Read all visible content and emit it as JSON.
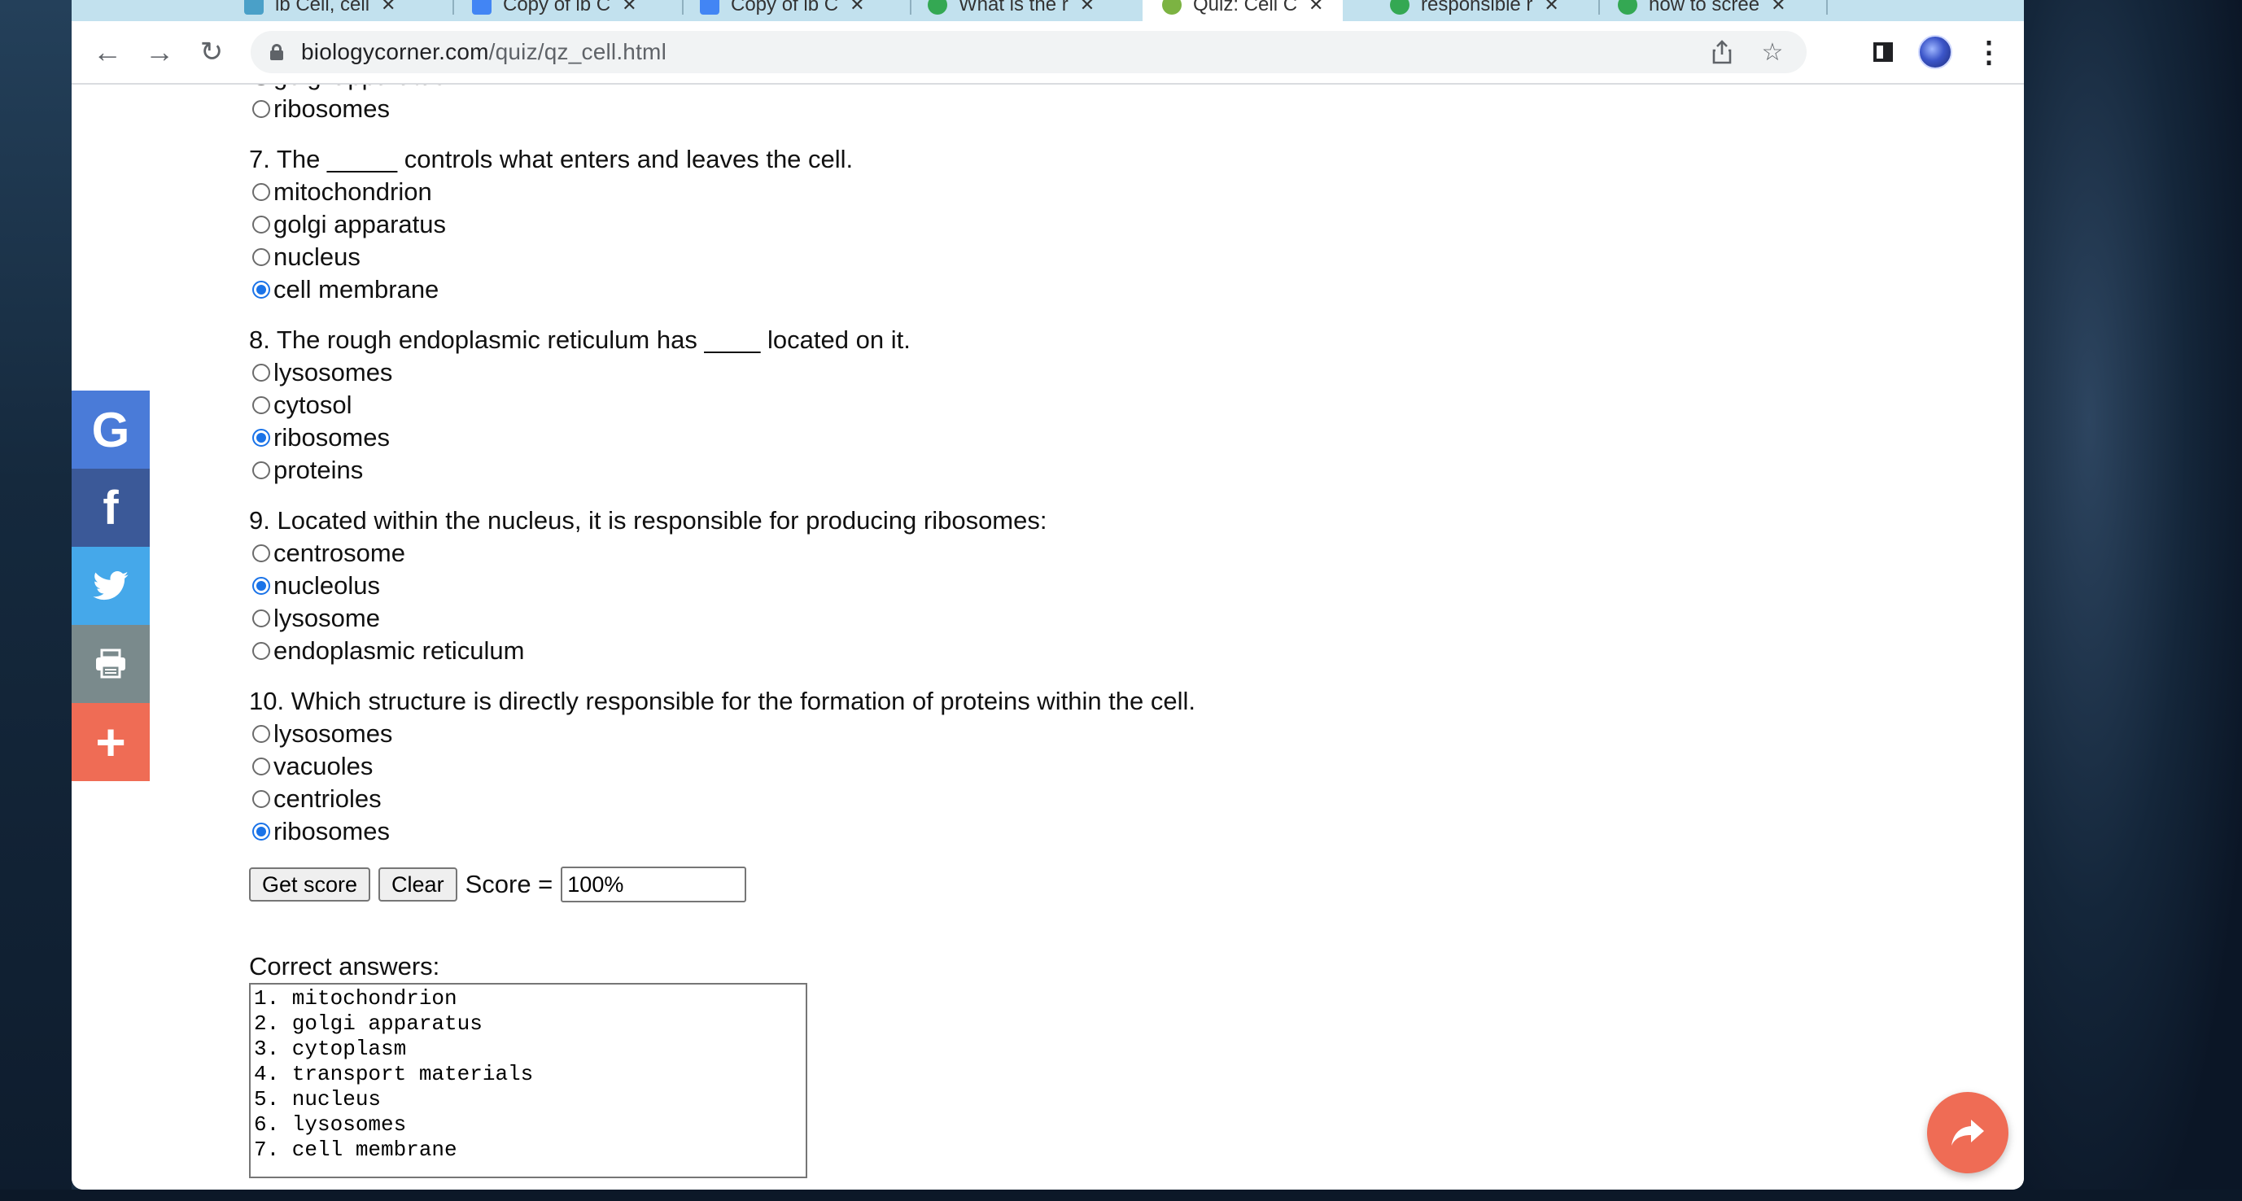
{
  "browser": {
    "tabs": [
      {
        "label": "ib Cell, cell"
      },
      {
        "label": "Copy of ib C"
      },
      {
        "label": "Copy of ib C"
      },
      {
        "label": "What is the r"
      },
      {
        "label": "Quiz: Cell C"
      },
      {
        "label": "responsible r"
      },
      {
        "label": "how to scree"
      }
    ],
    "url_domain": "biologycorner.com",
    "url_path": "/quiz/qz_cell.html"
  },
  "quiz": {
    "prev_options": [
      "golgi apparatus",
      "ribosomes"
    ],
    "questions": [
      {
        "text": "7. The _____ controls what enters and leaves the cell.",
        "options": [
          "mitochondrion",
          "golgi apparatus",
          "nucleus",
          "cell membrane"
        ]
      },
      {
        "text": "8. The rough endoplasmic reticulum has ____ located on it.",
        "options": [
          "lysosomes",
          "cytosol",
          "ribosomes",
          "proteins"
        ]
      },
      {
        "text": "9. Located within the nucleus, it is responsible for producing ribosomes:",
        "options": [
          "centrosome",
          "nucleolus",
          "lysosome",
          "endoplasmic reticulum"
        ]
      },
      {
        "text": "10. Which structure is directly responsible for the formation of proteins within the cell.",
        "options": [
          "lysosomes",
          "vacuoles",
          "centrioles",
          "ribosomes"
        ]
      }
    ],
    "get_score_label": "Get score",
    "clear_label": "Clear",
    "score_label": "Score =",
    "score_value": "100%",
    "answers_label": "Correct answers:",
    "answers_text": "1. mitochondrion\n2. golgi apparatus\n3. cytoplasm\n4. transport materials\n5. nucleus\n6. lysosomes\n7. cell membrane"
  },
  "share": {
    "google_glyph": "G",
    "facebook_glyph": "f",
    "more_glyph": "+"
  },
  "colors": {
    "accent": "#1a73e8",
    "tabstrip": "#c2e1ee",
    "share_orange": "#ef6c55"
  }
}
